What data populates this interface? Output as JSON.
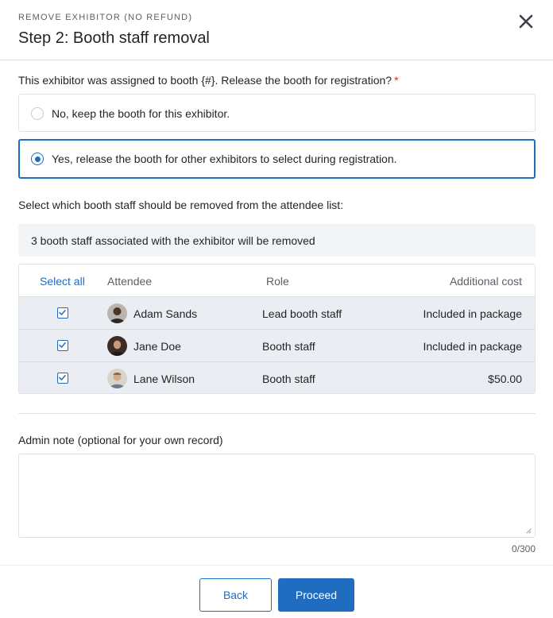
{
  "dialog": {
    "eyebrow": "REMOVE EXHIBITOR (NO REFUND)",
    "title": "Step 2: Booth staff removal"
  },
  "booth_question": {
    "label": "This exhibitor was assigned to booth {#}. Release the booth for registration?",
    "required_mark": "*",
    "options": [
      {
        "label": "No, keep the booth for this exhibitor.",
        "selected": false
      },
      {
        "label": "Yes, release the booth for other exhibitors to select during registration.",
        "selected": true
      }
    ]
  },
  "staff_section": {
    "label": "Select which booth staff should be removed from the attendee list:",
    "notice": "3 booth staff associated with the exhibitor will be removed",
    "table": {
      "select_all": "Select all",
      "columns": [
        "Attendee",
        "Role",
        "Additional cost"
      ],
      "rows": [
        {
          "checked": true,
          "name": "Adam Sands",
          "role": "Lead booth staff",
          "cost": "Included in package"
        },
        {
          "checked": true,
          "name": "Jane Doe",
          "role": "Booth staff",
          "cost": "Included in package"
        },
        {
          "checked": true,
          "name": "Lane Wilson",
          "role": "Booth staff",
          "cost": "$50.00"
        }
      ]
    }
  },
  "admin_note": {
    "label": "Admin note (optional for your own record)",
    "value": "",
    "counter": "0/300"
  },
  "footer": {
    "back_label": "Back",
    "proceed_label": "Proceed"
  },
  "colors": {
    "accent": "#1f6cc1",
    "required": "#d62d2d",
    "row_background": "#eaedf1"
  },
  "icons": [
    "close-icon",
    "checkbox-checked-icon",
    "resize-handle-icon"
  ]
}
